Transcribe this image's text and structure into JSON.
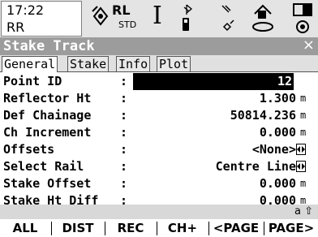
{
  "status": {
    "time": "17:22",
    "job": "RR",
    "rl_label": "RL",
    "std_label": "STD",
    "cursor_icon": "text-cursor-icon",
    "bluetooth_icon": "bluetooth-icon"
  },
  "window": {
    "title": "Stake Track",
    "close": "×"
  },
  "tabs": [
    {
      "label": "General",
      "active": true
    },
    {
      "label": "Stake",
      "active": false
    },
    {
      "label": "Info",
      "active": false
    },
    {
      "label": "Plot",
      "active": false
    }
  ],
  "fields": [
    {
      "label": "Point ID",
      "value": "12",
      "unit": ""
    },
    {
      "label": "Reflector Ht",
      "value": "1.300",
      "unit": "m"
    },
    {
      "label": "Def Chainage",
      "value": "50814.236",
      "unit": "m"
    },
    {
      "label": "Ch Increment",
      "value": "0.000",
      "unit": "m"
    },
    {
      "label": "Offsets",
      "value": "<None>",
      "unit": ""
    },
    {
      "label": "Select Rail",
      "value": "Centre Line",
      "unit": ""
    },
    {
      "label": "Stake Offset",
      "value": "0.000",
      "unit": "m"
    },
    {
      "label": "Stake Ht Diff",
      "value": "0.000",
      "unit": "m"
    }
  ],
  "input_mode": "a ⇧",
  "softkeys": [
    "ALL",
    "DIST",
    "REC",
    "CH+",
    "<PAGE",
    "PAGE>"
  ]
}
